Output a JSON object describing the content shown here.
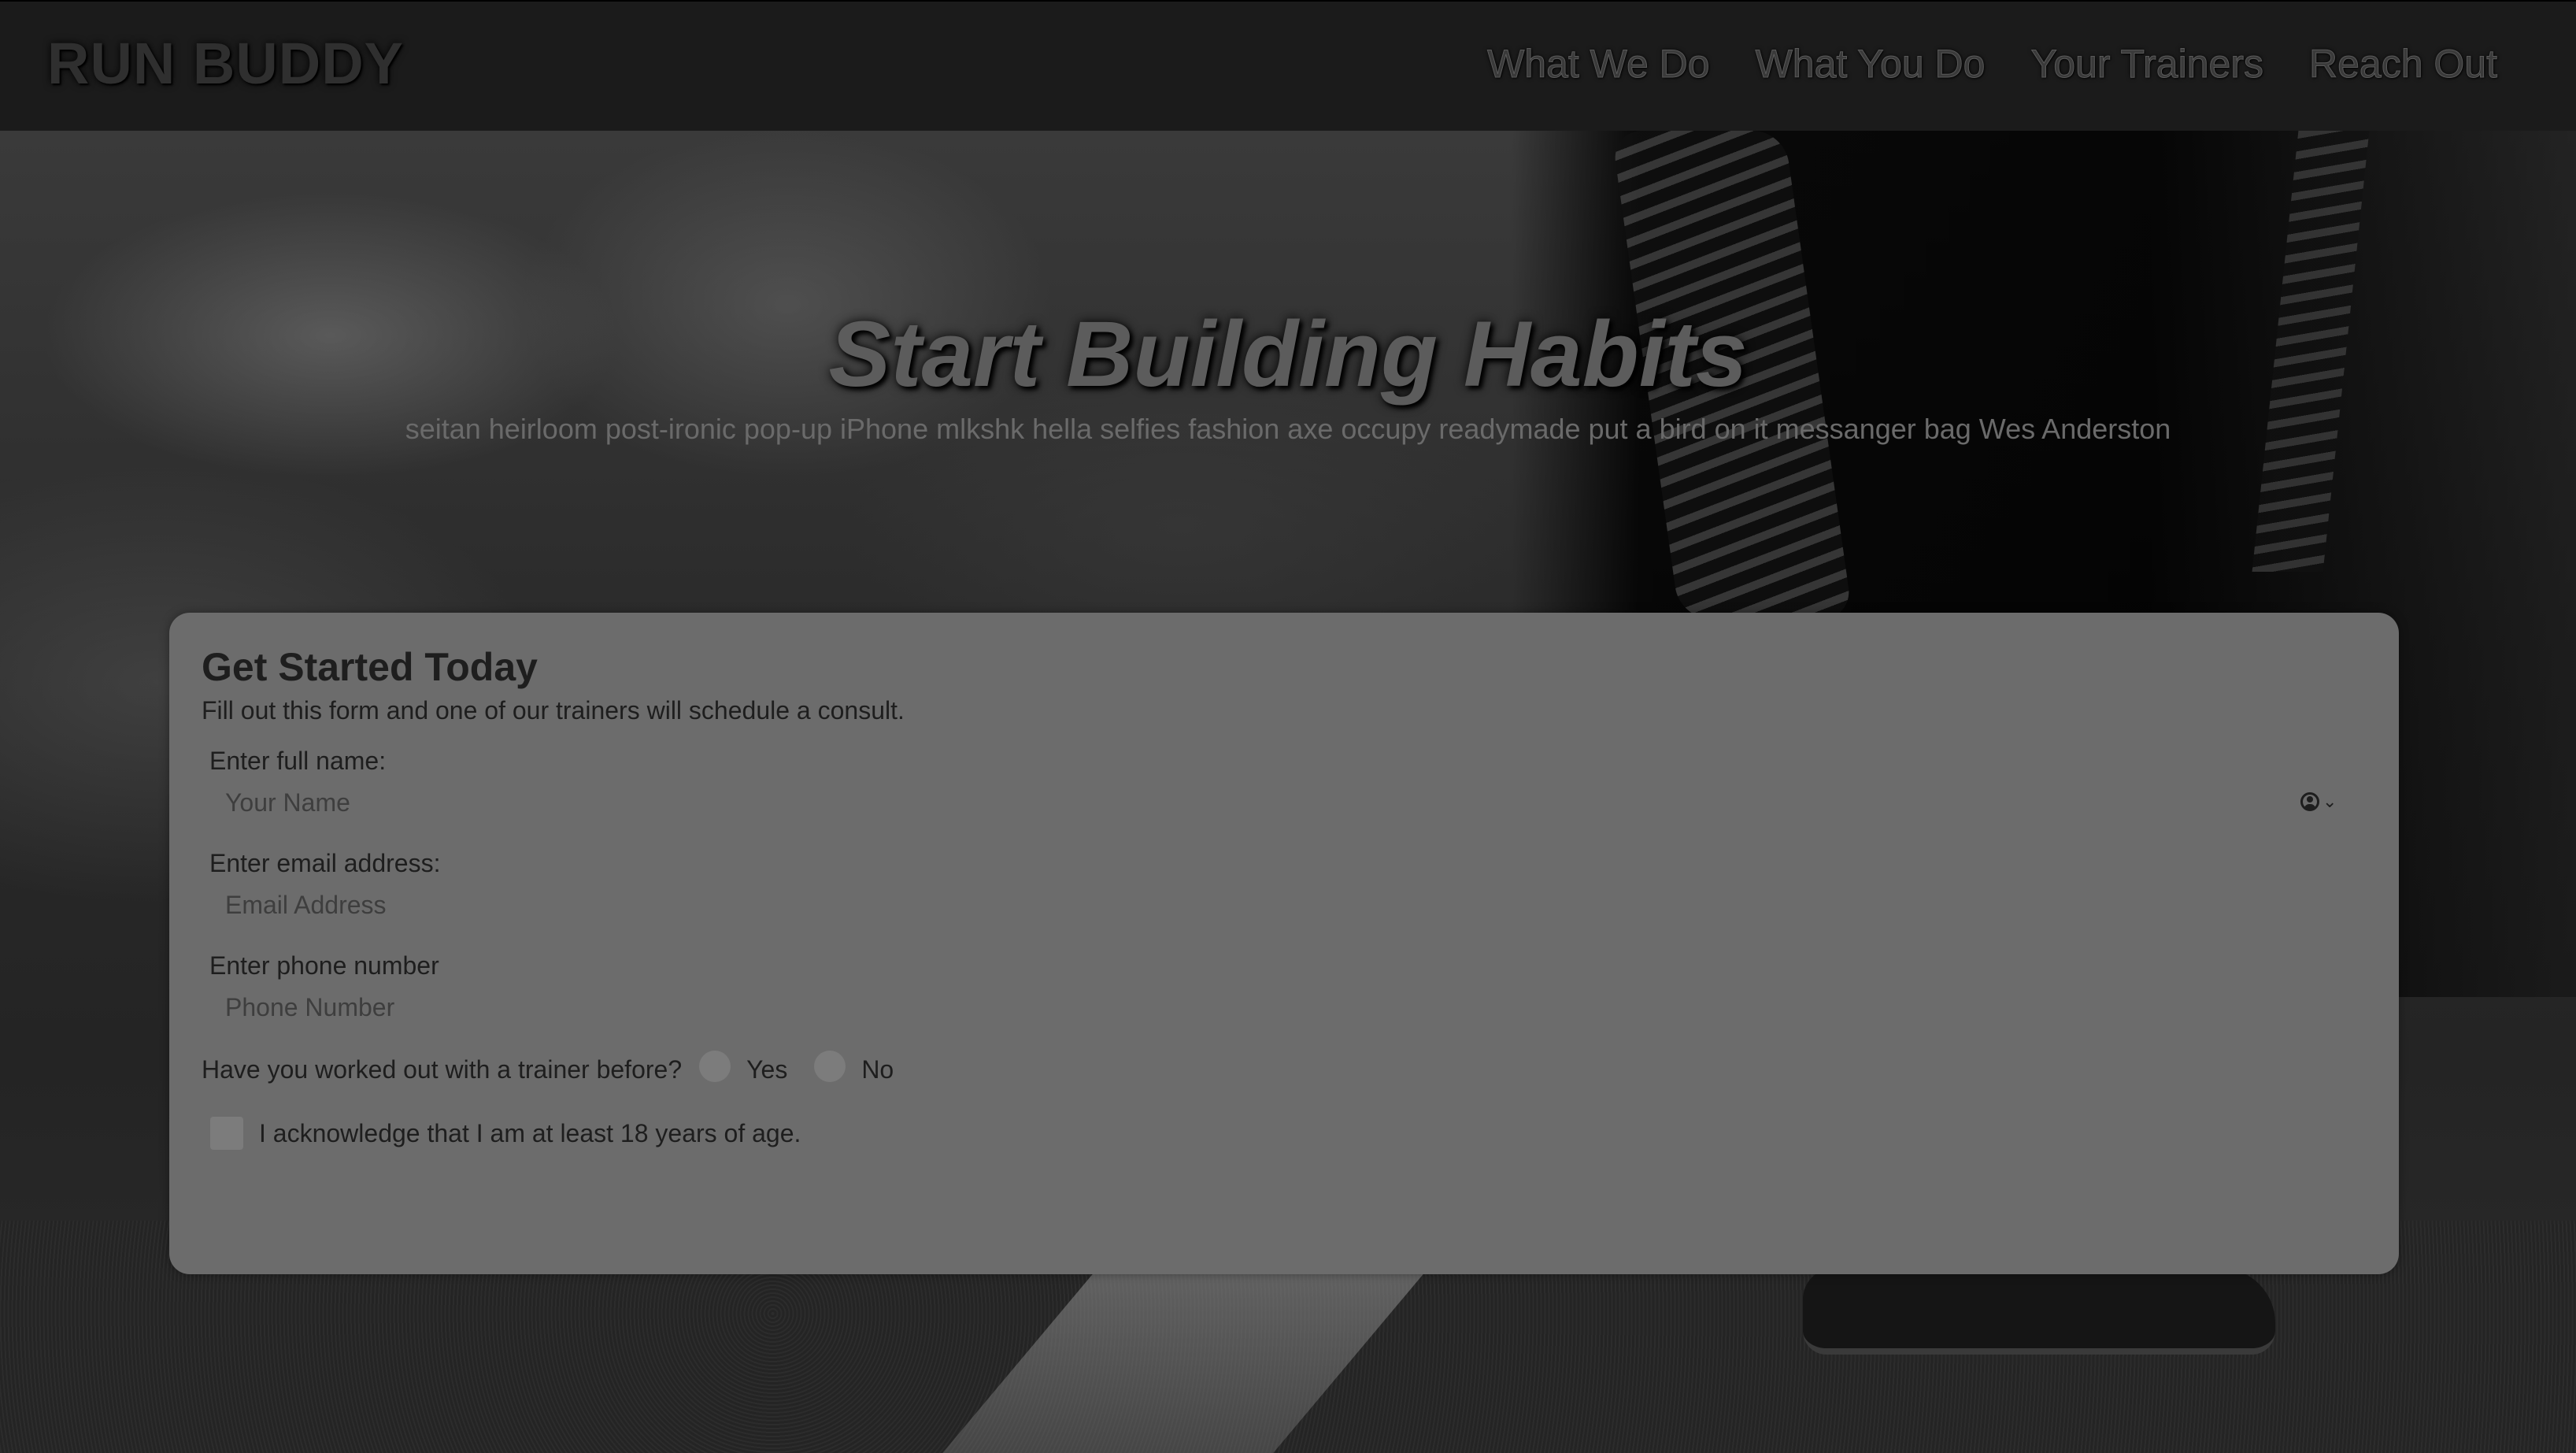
{
  "header": {
    "logo": "RUN BUDDY",
    "nav": [
      "What We Do",
      "What You Do",
      "Your Trainers",
      "Reach Out"
    ]
  },
  "hero": {
    "title": "Start Building Habits",
    "subtitle": "seitan heirloom post-ironic pop-up iPhone mlkshk hella selfies fashion axe occupy readymade put a bird on it messanger bag Wes Anderston"
  },
  "form": {
    "title": "Get Started Today",
    "description": "Fill out this form and one of our trainers will schedule a consult.",
    "name_label": "Enter full name:",
    "name_placeholder": "Your Name",
    "email_label": "Enter email address:",
    "email_placeholder": "Email Address",
    "phone_label": "Enter phone number",
    "phone_placeholder": "Phone Number",
    "trainer_question": "Have you worked out with a trainer before?",
    "option_yes": "Yes",
    "option_no": "No",
    "age_ack": "I acknowledge that I am at least 18 years of age."
  },
  "colors": {
    "header_bg": "#1b1b1b",
    "card_bg": "#6c6c6c",
    "text_dark": "#1e1e1e"
  }
}
